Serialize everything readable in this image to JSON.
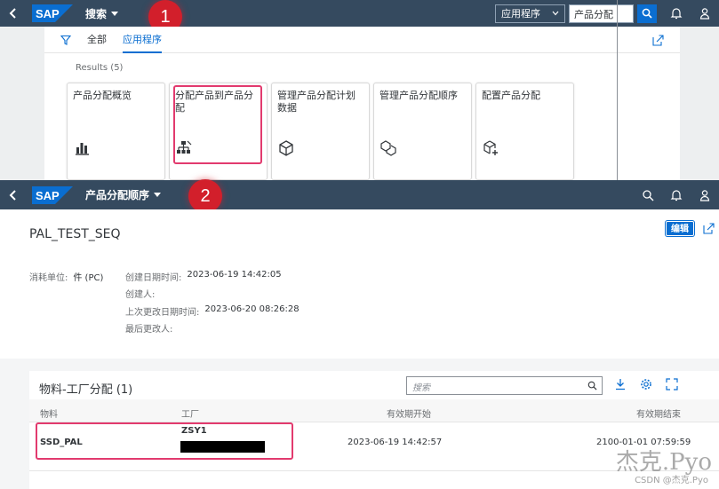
{
  "top_shell": {
    "logo": "SAP",
    "title": "搜索",
    "scope": "应用程序",
    "search_value": "产品分配",
    "callout": "1",
    "icons": [
      "back-icon",
      "search-icon",
      "bell-icon",
      "user-icon"
    ]
  },
  "results": {
    "tabs": [
      "全部",
      "应用程序"
    ],
    "active_tab": "应用程序",
    "count_label": "Results (5)",
    "tiles": [
      {
        "title": "产品分配概览",
        "icon": "chart-icon"
      },
      {
        "title": "分配产品到产品分配",
        "icon": "hierarchy-icon"
      },
      {
        "title": "管理产品分配计划数据",
        "icon": "cube-icon"
      },
      {
        "title": "管理产品分配顺序",
        "icon": "cubes-icon"
      },
      {
        "title": "配置产品分配",
        "icon": "add-cube-icon"
      }
    ]
  },
  "bottom_shell": {
    "logo": "SAP",
    "title": "产品分配顺序",
    "callout": "2"
  },
  "object": {
    "title": "PAL_TEST_SEQ",
    "edit_label": "编辑",
    "uom_label": "消耗单位:",
    "uom_value": "件 (PC)",
    "created_on_label": "创建日期时间:",
    "created_on_value": "2023-06-19 14:42:05",
    "created_by_label": "创建人:",
    "changed_on_label": "上次更改日期时间:",
    "changed_on_value": "2023-06-20 08:26:28",
    "changed_by_label": "最后更改人:"
  },
  "table": {
    "title": "物料-工厂分配 (1)",
    "search_placeholder": "搜索",
    "columns": [
      "物料",
      "工厂",
      "有效期开始",
      "有效期结束"
    ],
    "rows": [
      {
        "material": "SSD_PAL",
        "plant": "ZSY1",
        "valid_from": "2023-06-19 14:42:57",
        "valid_to": "2100-01-01 07:59:59"
      }
    ]
  },
  "watermark": {
    "main": "杰克.Pyo",
    "sub": "CSDN @杰克.Pyo"
  },
  "colors": {
    "shell": "#354a5f",
    "accent": "#0a6ed1",
    "callout": "#d21f2b",
    "highlight": "#e23a6e"
  }
}
